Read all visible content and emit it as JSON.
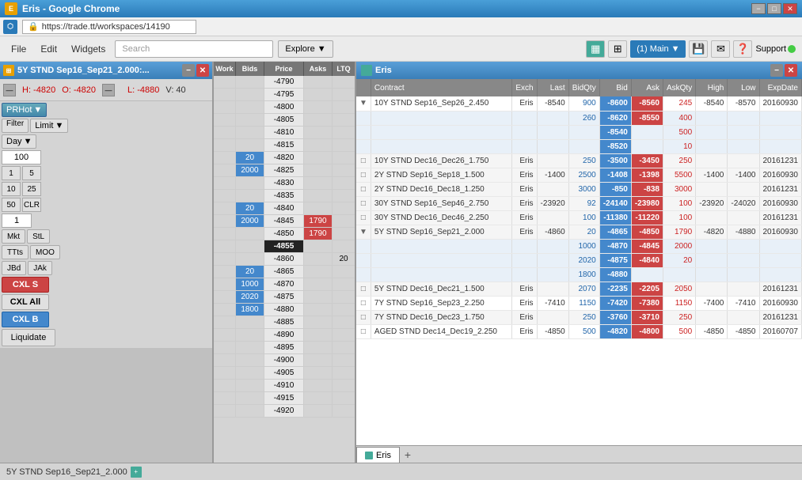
{
  "titleBar": {
    "title": "Eris - Google Chrome",
    "icon": "E"
  },
  "urlBar": {
    "url": "https://trade.tt/workspaces/14190"
  },
  "menuBar": {
    "file": "File",
    "edit": "Edit",
    "widgets": "Widgets",
    "searchPlaceholder": "Search",
    "explore": "Explore"
  },
  "toolbar": {
    "main": "(1) Main",
    "support": "Support"
  },
  "leftWidget": {
    "title": "5Y STND Sep16_Sep21_2.000:...",
    "minusBtn": "−",
    "closeBtn": "✕",
    "high": "H: -4820",
    "low": "L: -4880",
    "open": "O: -4820",
    "volume": "V: 40"
  },
  "controls": {
    "prhot": "PRHot",
    "work": "Work",
    "bids": "Bids",
    "price": "Price",
    "asks": "Asks",
    "filter": "Filter",
    "limit": "Limit",
    "day": "Day",
    "qty100": "100",
    "qty1": "1",
    "qty5": "5",
    "qty10": "10",
    "qty25": "25",
    "qty50": "50",
    "clr": "CLR",
    "qty1b": "1",
    "mkt": "Mkt",
    "stl": "StL",
    "tts": "TTts",
    "moo": "MOO",
    "jbd": "JBd",
    "jak": "JAk",
    "cxls": "CXL S",
    "cxlall": "CXL All",
    "cxlb": "CXL B",
    "liquidate": "Liquidate"
  },
  "ladder": {
    "headers": [
      "Work",
      "Bids",
      "Price",
      "Asks",
      "LTQ"
    ],
    "rows": [
      {
        "work": "",
        "bids": "",
        "price": "-4790",
        "asks": "",
        "ltq": ""
      },
      {
        "work": "",
        "bids": "",
        "price": "-4795",
        "asks": "",
        "ltq": ""
      },
      {
        "work": "",
        "bids": "",
        "price": "-4800",
        "asks": "",
        "ltq": ""
      },
      {
        "work": "",
        "bids": "",
        "price": "-4805",
        "asks": "",
        "ltq": ""
      },
      {
        "work": "",
        "bids": "",
        "price": "-4810",
        "asks": "",
        "ltq": ""
      },
      {
        "work": "",
        "bids": "",
        "price": "-4815",
        "asks": "",
        "ltq": ""
      },
      {
        "work": "",
        "bids": "20",
        "price": "-4820",
        "asks": "",
        "ltq": "",
        "bid": true
      },
      {
        "work": "",
        "bids": "2000",
        "price": "-4825",
        "asks": "",
        "ltq": "",
        "bid": true
      },
      {
        "work": "",
        "bids": "",
        "price": "-4830",
        "asks": "",
        "ltq": ""
      },
      {
        "work": "",
        "bids": "",
        "price": "-4835",
        "asks": "",
        "ltq": ""
      },
      {
        "work": "",
        "bids": "20",
        "price": "-4840",
        "asks": "",
        "ltq": "",
        "bid": true
      },
      {
        "work": "",
        "bids": "2000",
        "price": "-4845",
        "asks": "1790",
        "ltq": "",
        "bid": true,
        "ask": true
      },
      {
        "work": "",
        "bids": "",
        "price": "-4850",
        "asks": "1790",
        "ltq": "",
        "ask": true
      },
      {
        "work": "",
        "bids": "",
        "price": "-4855",
        "asks": "",
        "ltq": "",
        "highlight": true
      },
      {
        "work": "",
        "bids": "",
        "price": "-4860",
        "asks": "",
        "ltq": "20"
      },
      {
        "work": "",
        "bids": "20",
        "price": "-4865",
        "asks": "",
        "ltq": "",
        "bid": true
      },
      {
        "work": "",
        "bids": "1000",
        "price": "-4870",
        "asks": "",
        "ltq": "",
        "bid": true
      },
      {
        "work": "",
        "bids": "2020",
        "price": "-4875",
        "asks": "",
        "ltq": "",
        "bid": true
      },
      {
        "work": "",
        "bids": "1800",
        "price": "-4880",
        "asks": "",
        "ltq": "",
        "bid": true
      },
      {
        "work": "",
        "bids": "",
        "price": "-4885",
        "asks": "",
        "ltq": ""
      },
      {
        "work": "",
        "bids": "",
        "price": "-4890",
        "asks": "",
        "ltq": ""
      },
      {
        "work": "",
        "bids": "",
        "price": "-4895",
        "asks": "",
        "ltq": ""
      },
      {
        "work": "",
        "bids": "",
        "price": "-4900",
        "asks": "",
        "ltq": ""
      },
      {
        "work": "",
        "bids": "",
        "price": "-4905",
        "asks": "",
        "ltq": ""
      },
      {
        "work": "",
        "bids": "",
        "price": "-4910",
        "asks": "",
        "ltq": ""
      },
      {
        "work": "",
        "bids": "",
        "price": "-4915",
        "asks": "",
        "ltq": ""
      },
      {
        "work": "",
        "bids": "",
        "price": "-4920",
        "asks": "",
        "ltq": ""
      }
    ]
  },
  "grid": {
    "title": "Eris",
    "headers": [
      "Contract",
      "Exch",
      "Last",
      "BidQty",
      "Bid",
      "Ask",
      "AskQty",
      "High",
      "Low",
      "ExpDate"
    ],
    "rows": [
      {
        "expand": "▼",
        "contract": "10Y STND Sep16_Sep26_2.450",
        "exch": "Eris",
        "last": "-8540",
        "bidqty": "900",
        "bid": "-8600",
        "ask": "-8560",
        "askqty": "245",
        "high": "-8540",
        "low": "-8570",
        "expdate": "20160930",
        "hasBid": true,
        "hasAsk": true,
        "subrows": [
          {
            "bidqty": "260",
            "bid": "-8620",
            "ask": "-8550",
            "askqty": "400"
          },
          {
            "bid": "-8540",
            "ask": "",
            "askqty": "500"
          },
          {
            "bid": "-8520",
            "ask": "",
            "askqty": "10"
          }
        ]
      },
      {
        "expand": "□",
        "contract": "10Y STND Dec16_Dec26_1.750",
        "exch": "Eris",
        "last": "",
        "bidqty": "250",
        "bid": "-3500",
        "ask": "-3450",
        "askqty": "250",
        "high": "",
        "low": "",
        "expdate": "20161231",
        "hasBid": true,
        "hasAsk": true
      },
      {
        "expand": "□",
        "contract": "2Y STND Sep16_Sep18_1.500",
        "exch": "Eris",
        "last": "-1400",
        "bidqty": "2500",
        "bid": "-1408",
        "ask": "-1398",
        "askqty": "5500",
        "high": "-1400",
        "low": "-1400",
        "expdate": "20160930",
        "hasBid": true,
        "hasAsk": true
      },
      {
        "expand": "□",
        "contract": "2Y STND Dec16_Dec18_1.250",
        "exch": "Eris",
        "last": "",
        "bidqty": "3000",
        "bid": "-850",
        "ask": "-838",
        "askqty": "3000",
        "high": "",
        "low": "",
        "expdate": "20161231",
        "hasBid": true,
        "hasAsk": true
      },
      {
        "expand": "□",
        "contract": "30Y STND Sep16_Sep46_2.750",
        "exch": "Eris",
        "last": "-23920",
        "bidqty": "92",
        "bid": "-24140",
        "ask": "-23980",
        "askqty": "100",
        "high": "-23920",
        "low": "-24020",
        "expdate": "20160930",
        "hasBid": true,
        "hasAsk": true
      },
      {
        "expand": "□",
        "contract": "30Y STND Dec16_Dec46_2.250",
        "exch": "Eris",
        "last": "",
        "bidqty": "100",
        "bid": "-11380",
        "ask": "-11220",
        "askqty": "100",
        "high": "",
        "low": "",
        "expdate": "20161231",
        "hasBid": true,
        "hasAsk": true
      },
      {
        "expand": "▼",
        "contract": "5Y STND Sep16_Sep21_2.000",
        "exch": "Eris",
        "last": "-4860",
        "bidqty": "20",
        "bid": "-4865",
        "ask": "-4850",
        "askqty": "1790",
        "high": "-4820",
        "low": "-4880",
        "expdate": "20160930",
        "hasBid": true,
        "hasAsk": true,
        "subrows": [
          {
            "bidqty": "1000",
            "bid": "-4870",
            "ask": "-4845",
            "askqty": "2000"
          },
          {
            "bidqty": "2020",
            "bid": "-4875",
            "ask": "-4840",
            "askqty": "20"
          },
          {
            "bidqty": "1800",
            "bid": "-4880",
            "ask": "",
            "askqty": ""
          }
        ]
      },
      {
        "expand": "□",
        "contract": "5Y STND Dec16_Dec21_1.500",
        "exch": "Eris",
        "last": "",
        "bidqty": "2070",
        "bid": "-2235",
        "ask": "-2205",
        "askqty": "2050",
        "high": "",
        "low": "",
        "expdate": "20161231",
        "hasBid": true,
        "hasAsk": true
      },
      {
        "expand": "□",
        "contract": "7Y STND Sep16_Sep23_2.250",
        "exch": "Eris",
        "last": "-7410",
        "bidqty": "1150",
        "bid": "-7420",
        "ask": "-7380",
        "askqty": "1150",
        "high": "-7400",
        "low": "-7410",
        "expdate": "20160930",
        "hasBid": true,
        "hasAsk": true
      },
      {
        "expand": "□",
        "contract": "7Y STND Dec16_Dec23_1.750",
        "exch": "Eris",
        "last": "",
        "bidqty": "250",
        "bid": "-3760",
        "ask": "-3710",
        "askqty": "250",
        "high": "",
        "low": "",
        "expdate": "20161231",
        "hasBid": true,
        "hasAsk": true
      },
      {
        "expand": "□",
        "contract": "AGED STND Dec14_Dec19_2.250",
        "exch": "Eris",
        "last": "-4850",
        "bidqty": "500",
        "bid": "-4820",
        "ask": "-4800",
        "askqty": "500",
        "high": "-4850",
        "low": "-4850",
        "expdate": "20160707",
        "hasBid": true,
        "hasAsk": true
      }
    ]
  },
  "tabs": [
    {
      "label": "Eris",
      "active": true
    },
    {
      "label": "+",
      "isAdd": true
    }
  ],
  "statusBar": {
    "text": "5Y STND Sep16_Sep21_2.000"
  }
}
